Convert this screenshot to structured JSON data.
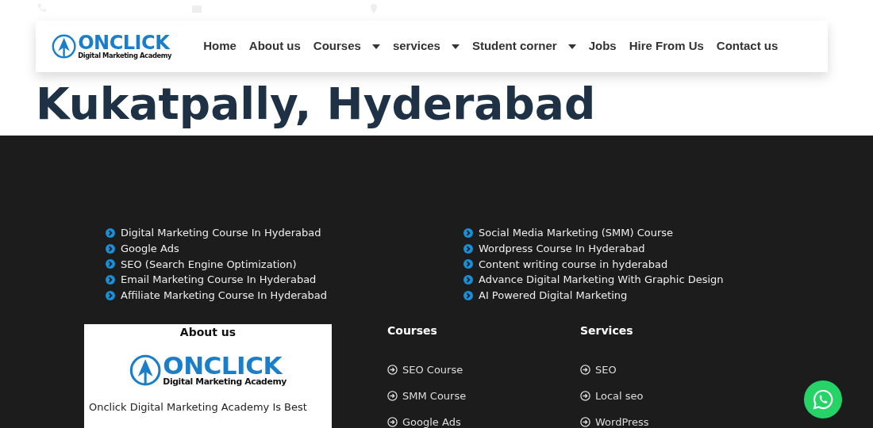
{
  "logo": {
    "name": "ONCLICK",
    "tagline": "Digital Marketing Academy"
  },
  "nav": [
    {
      "label": "Home",
      "dropdown": false
    },
    {
      "label": "About us",
      "dropdown": false
    },
    {
      "label": "Courses",
      "dropdown": true
    },
    {
      "label": "services",
      "dropdown": true
    },
    {
      "label": "Student corner",
      "dropdown": true
    },
    {
      "label": "Jobs",
      "dropdown": false
    },
    {
      "label": "Hire From Us",
      "dropdown": false
    },
    {
      "label": "Contact us",
      "dropdown": false
    }
  ],
  "heading": "Kukatpally, Hyderabad",
  "course_links": {
    "left": [
      "Digital Marketing Course In Hyderabad",
      "Google Ads",
      "SEO (Search Engine Optimization)",
      "Email Marketing Course In Hyderabad",
      "Affiliate Marketing Course In Hyderabad"
    ],
    "right": [
      "Social Media Marketing (SMM) Course",
      "Wordpress Course In Hyderabad",
      "Content writing course in hyderabad",
      "Advance Digital Marketing With Graphic Design",
      "AI Powered Digital Marketing"
    ]
  },
  "about": {
    "title": "About us",
    "logo": {
      "name": "ONCLICK",
      "tagline": "Digital Marketing Academy"
    },
    "text": "Onclick Digital Marketing Academy Is Best"
  },
  "courses": {
    "title": "Courses",
    "items": [
      "SEO Course",
      "SMM Course",
      "Google Ads"
    ]
  },
  "services": {
    "title": "Services",
    "items": [
      "SEO",
      "Local seo",
      "WordPress"
    ]
  }
}
